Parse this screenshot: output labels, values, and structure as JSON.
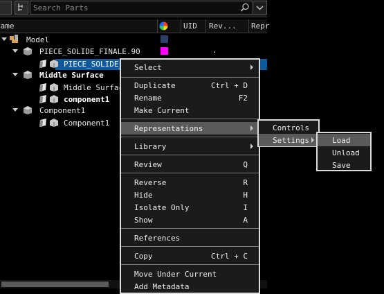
{
  "toolbar": {
    "search_placeholder": "Search Parts"
  },
  "columns": {
    "name": "Name",
    "uid": "UID",
    "rev": "Rev...",
    "repr": "Repr"
  },
  "tree": {
    "model": "Model",
    "piece_finale": "PIECE_SOLIDE_FINALE.90",
    "piece_selected": "PIECE_SOLIDE_",
    "middle_surface": "Middle Surface",
    "middle_surface_child": "Middle Surfac",
    "component1_bold": "component1",
    "component1_parent": "Component1",
    "component1_child": "Component1",
    "rev_dot": "."
  },
  "colors": {
    "model_swatch": "#2b3f6b",
    "finale_swatch": "#ff00ff",
    "selection": "#0e5a9c"
  },
  "context_menu": {
    "select": "Select",
    "duplicate": "Duplicate",
    "duplicate_sc": "Ctrl + D",
    "rename": "Rename",
    "rename_sc": "F2",
    "make_current": "Make Current",
    "representations": "Representations",
    "library": "Library",
    "review": "Review",
    "review_sc": "Q",
    "reverse": "Reverse",
    "reverse_sc": "R",
    "hide": "Hide",
    "hide_sc": "H",
    "isolate_only": "Isolate Only",
    "isolate_sc": "I",
    "show": "Show",
    "show_sc": "A",
    "references": "References",
    "copy": "Copy",
    "copy_sc": "Ctrl + C",
    "move_under_current": "Move Under Current",
    "add_metadata": "Add Metadata"
  },
  "representations_menu": {
    "controls": "Controls",
    "settings": "Settings"
  },
  "settings_menu": {
    "load": "Load",
    "unload": "Unload",
    "save": "Save"
  }
}
